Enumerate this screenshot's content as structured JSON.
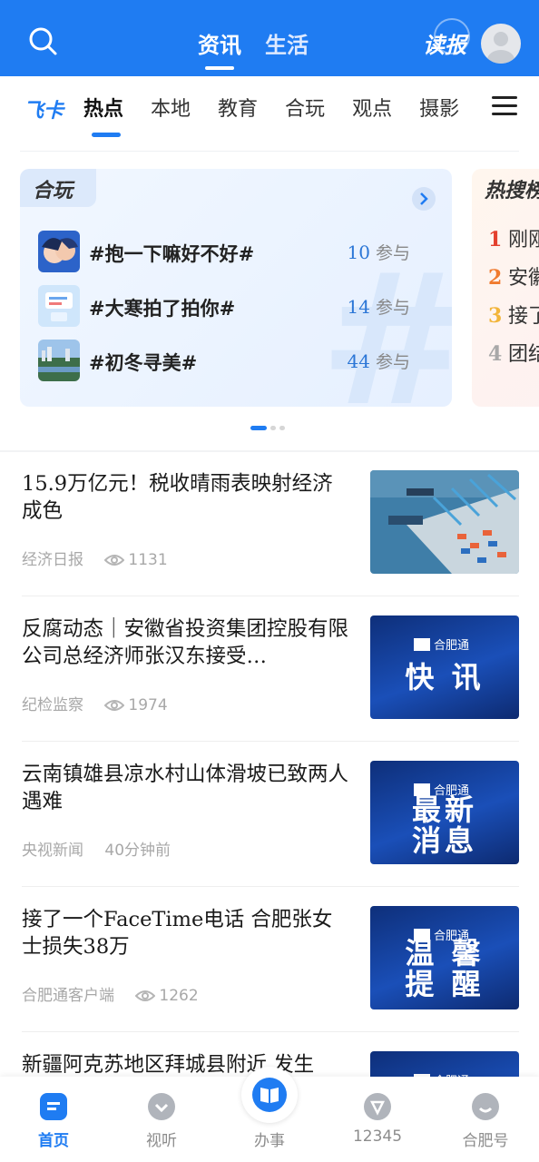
{
  "header": {
    "tabs": [
      {
        "label": "资讯",
        "active": true
      },
      {
        "label": "生活",
        "active": false
      }
    ],
    "dubao_label": "读报"
  },
  "categories": {
    "feika_label": "飞卡",
    "items": [
      "热点",
      "本地",
      "教育",
      "合玩",
      "观点",
      "摄影"
    ],
    "active_index": 0
  },
  "hewan_card": {
    "title": "合玩",
    "topics": [
      {
        "name": "#抱一下嘛好不好#",
        "count": "10",
        "unit": "参与"
      },
      {
        "name": "#大寒拍了拍你#",
        "count": "14",
        "unit": "参与"
      },
      {
        "name": "#初冬寻美#",
        "count": "44",
        "unit": "参与"
      }
    ]
  },
  "hot_card": {
    "title": "热搜榜",
    "items": [
      {
        "rank": "1",
        "text": "刚刚",
        "color": "#e4402e"
      },
      {
        "rank": "2",
        "text": "安徽",
        "color": "#f07a2e"
      },
      {
        "rank": "3",
        "text": "接了",
        "color": "#f2b53a"
      },
      {
        "rank": "4",
        "text": "团结",
        "color": "#a8a8a8"
      }
    ]
  },
  "news": [
    {
      "headline": "15.9万亿元！税收晴雨表映射经济成色",
      "source": "经济日报",
      "views": "1131",
      "image": "port-photo"
    },
    {
      "headline": "反腐动态｜安徽省投资集团控股有限公司总经济师张汉东接受…",
      "source": "纪检监察",
      "views": "1974",
      "image": "card",
      "card_brand": "合肥通",
      "card_lines": [
        "快 讯"
      ]
    },
    {
      "headline": "云南镇雄县凉水村山体滑坡已致两人遇难",
      "source": "央视新闻",
      "time": "40分钟前",
      "image": "card",
      "card_brand": "合肥通",
      "card_lines": [
        "最新",
        "消息"
      ]
    },
    {
      "headline": "接了一个FaceTime电话 合肥张女士损失38万",
      "source": "合肥通客户端",
      "views": "1262",
      "image": "card",
      "card_brand": "合肥通",
      "card_lines": [
        "温 馨",
        "提 醒"
      ]
    },
    {
      "headline": "新疆阿克苏地区拜城县附近 发生",
      "image": "card",
      "card_brand": "合肥通"
    }
  ],
  "bottom_nav": [
    {
      "label": "首页",
      "icon": "home-icon",
      "active": true
    },
    {
      "label": "视听",
      "icon": "video-icon",
      "active": false
    },
    {
      "label": "办事",
      "icon": "book-icon",
      "active": false
    },
    {
      "label": "12345",
      "icon": "hotline-icon",
      "active": false
    },
    {
      "label": "合肥号",
      "icon": "account-icon",
      "active": false
    }
  ],
  "colors": {
    "primary": "#1f7cf2",
    "text": "#1a1a1a",
    "muted": "#a8a8a8"
  }
}
